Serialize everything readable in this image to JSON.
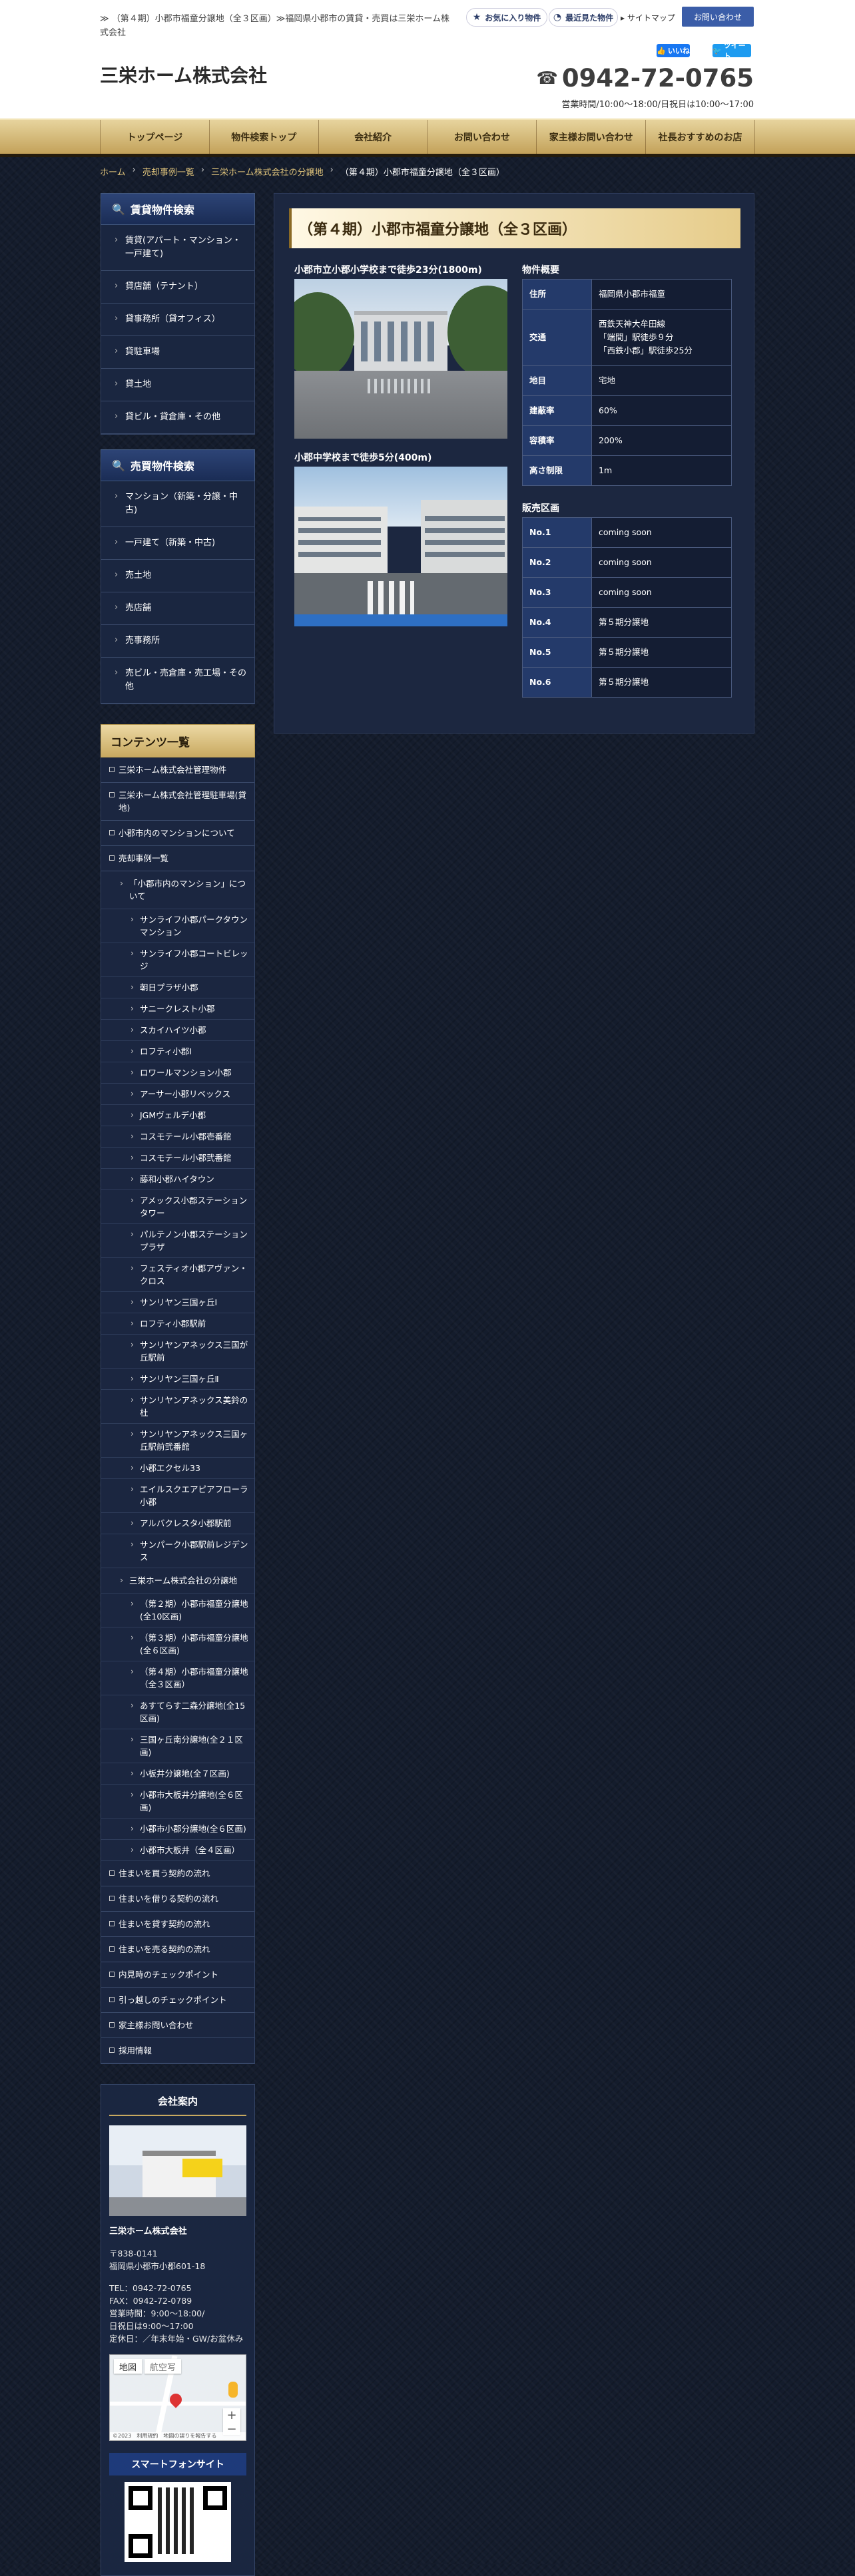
{
  "header": {
    "tagline": "≫ （第４期）小郡市福童分譲地（全３区画）≫福岡県小郡市の賃貸・売買は三栄ホーム株式会社",
    "fav_label": "お気に入り物件",
    "recent_label": "最近見た物件",
    "sitemap_label": "サイトマップ",
    "contact_label": "お問い合わせ",
    "fb_like": "いいね",
    "tw_like": "ツイート",
    "logo": "三栄ホーム株式会社",
    "phone": "0942-72-0765",
    "hours": "営業時間/10:00～18:00/日祝日は10:00～17:00"
  },
  "nav": [
    "トップページ",
    "物件検索トップ",
    "会社紹介",
    "お問い合わせ",
    "家主様お問い合わせ",
    "社長おすすめのお店"
  ],
  "breadcrumb": {
    "home": "ホーム",
    "cases": "売却事例一覧",
    "company": "三栄ホーム株式会社の分譲地",
    "current": "（第４期）小郡市福童分譲地（全３区画）"
  },
  "sidebar": {
    "rent_head": "賃貸物件検索",
    "rent_items": [
      "賃貸(アパート・マンション・一戸建て)",
      "貸店舗（テナント）",
      "貸事務所（貸オフィス）",
      "貸駐車場",
      "貸土地",
      "貸ビル・貸倉庫・その他"
    ],
    "sale_head": "売買物件検索",
    "sale_items": [
      "マンション（新築・分譲・中古)",
      "一戸建て（新築・中古)",
      "売土地",
      "売店舗",
      "売事務所",
      "売ビル・売倉庫・売工場・その他"
    ],
    "contents_head": "コンテンツ一覧",
    "contents_top": [
      "三栄ホーム株式会社管理物件",
      "三栄ホーム株式会社管理駐車場(貸地)",
      "小郡市内のマンションについて",
      "売却事例一覧"
    ],
    "mansion_head": "「小郡市内のマンション」について",
    "mansions": [
      "サンライフ小郡パークタウンマンション",
      "サンライフ小郡コートビレッジ",
      "朝日プラザ小郡",
      "サニークレスト小郡",
      "スカイハイツ小郡",
      "ロフティ小郡Ⅰ",
      "ロワールマンション小郡",
      "アーサー小郡リベックス",
      "JGMヴェルデ小郡",
      "コスモテール小郡壱番館",
      "コスモテール小郡弐番館",
      "藤和小郡ハイタウン",
      "アメックス小郡ステーションタワー",
      "パルテノン小郡ステーションプラザ",
      "フェスティオ小郡アヴァン・クロス",
      "サンリヤン三国ヶ丘Ⅰ",
      "ロフティ小郡駅前",
      "サンリヤンアネックス三国が丘駅前",
      "サンリヤン三国ヶ丘Ⅱ",
      "サンリヤンアネックス美鈴の杜",
      "サンリヤンアネックス三国ヶ丘駅前弐番館",
      "小郡エクセル33",
      "エイルスクエアピアフローラ小郡",
      "アルバクレスタ小郡駅前",
      "サンパーク小郡駅前レジデンス"
    ],
    "bunjo_head": "三栄ホーム株式会社の分譲地",
    "bunjo": [
      "（第２期）小郡市福童分譲地(全10区画)",
      "（第３期）小郡市福童分譲地(全６区画)",
      "（第４期）小郡市福童分譲地（全３区画）",
      "あすてらす二森分譲地(全15区画)",
      "三国ヶ丘南分譲地(全２１区画)",
      "小板井分譲地(全７区画)",
      "小郡市大板井分譲地(全６区画)",
      "小郡市小郡分譲地(全６区画)",
      "小郡市大板井（全４区画）"
    ],
    "contents_bottom": [
      "住まいを買う契約の流れ",
      "住まいを借りる契約の流れ",
      "住まいを貸す契約の流れ",
      "住まいを売る契約の流れ",
      "内見時のチェックポイント",
      "引っ越しのチェックポイント",
      "家主様お問い合わせ",
      "採用情報"
    ],
    "company_head": "会社案内",
    "company_name": "三栄ホーム株式会社",
    "company_addr": "〒838-0141\n福岡県小郡市小郡601-18",
    "company_contact": "TEL：0942-72-0765\nFAX：0942-72-0789\n営業時間：9:00～18:00/\n日祝日は9:00～17:00\n定休日：／年末年始・GW/お盆休み",
    "map_tab1": "地図",
    "map_tab2": "航空写",
    "map_footer": "©2023　利用規約　地図の誤りを報告する",
    "smartphone_head": "スマートフォンサイト"
  },
  "main": {
    "title": "（第４期）小郡市福童分譲地（全３区画）",
    "photo1_caption": "小郡市立小郡小学校まで徒歩23分(1800m)",
    "photo2_caption": "小郡中学校まで徒歩5分(400m)",
    "overview_head": "物件概要",
    "overview": [
      {
        "k": "住所",
        "v": "福岡県小郡市福童"
      },
      {
        "k": "交通",
        "v": "西鉄天神大牟田線\n「端間」駅徒歩９分\n「西鉄小郡」駅徒歩25分"
      },
      {
        "k": "地目",
        "v": "宅地"
      },
      {
        "k": "建蔽率",
        "v": "60%"
      },
      {
        "k": "容積率",
        "v": "200%"
      },
      {
        "k": "高さ制限",
        "v": "1m"
      }
    ],
    "sales_head": "販売区画",
    "sales": [
      {
        "k": "No.1",
        "v": "coming soon"
      },
      {
        "k": "No.2",
        "v": "coming soon"
      },
      {
        "k": "No.3",
        "v": "coming soon"
      },
      {
        "k": "No.4",
        "v": "第５期分譲地"
      },
      {
        "k": "No.5",
        "v": "第５期分譲地"
      },
      {
        "k": "No.6",
        "v": "第５期分譲地"
      }
    ]
  },
  "colors": {
    "accent": "#c8a960",
    "nav_bg": "#d9bf7f",
    "brand_blue": "#3b5da8"
  },
  "icons": {
    "fav": "star-icon",
    "recent": "history-icon",
    "phone": "phone-icon",
    "search": "search-icon"
  }
}
